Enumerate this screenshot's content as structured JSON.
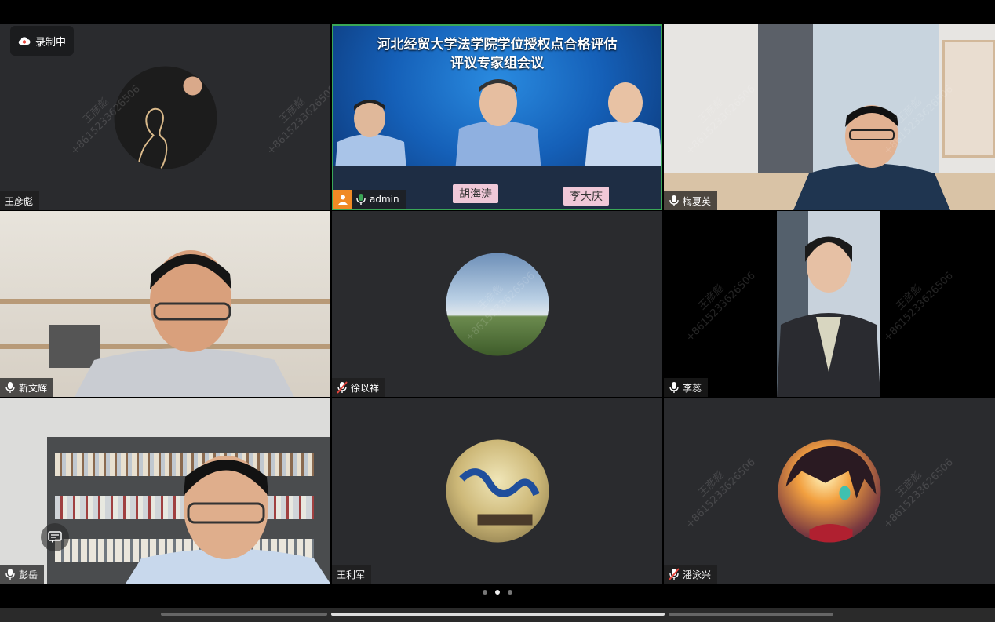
{
  "recording": {
    "label": "录制中"
  },
  "watermark": {
    "name": "王彦彪",
    "phone": "+8615233626506"
  },
  "tiles": [
    {
      "name": "王彦彪",
      "mic": "none"
    },
    {
      "name": "admin",
      "mic": "on",
      "banner_line1": "河北经贸大学法学院学位授权点合格评估",
      "banner_line2": "评议专家组会议",
      "plates": [
        "胡海涛",
        "李大庆"
      ]
    },
    {
      "name": "梅夏英",
      "mic": "on"
    },
    {
      "name": "靳文辉",
      "mic": "on"
    },
    {
      "name": "徐以祥",
      "mic": "muted"
    },
    {
      "name": "李蕊",
      "mic": "on"
    },
    {
      "name": "彭岳",
      "mic": "on"
    },
    {
      "name": "王利军",
      "mic": "none"
    },
    {
      "name": "潘泳兴",
      "mic": "muted"
    }
  ],
  "pagination": {
    "pages": 3,
    "current": 2
  },
  "colors": {
    "muted_icon": "#e8453c",
    "active_speaker_border": "#3aa757",
    "tile_bg": "#2a2b2e"
  }
}
